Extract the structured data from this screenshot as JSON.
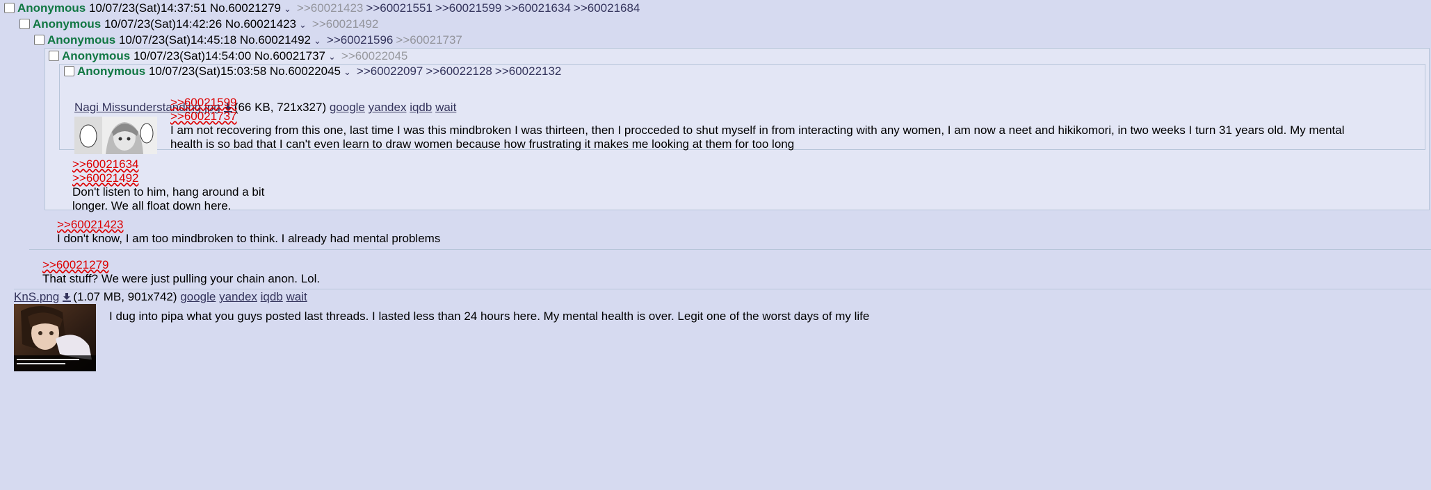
{
  "posts": [
    {
      "name": "Anonymous",
      "datetime": "10/07/23(Sat)14:37:51",
      "no": "No.60021279",
      "backlinks": [
        ">>60021423",
        ">>60021551",
        ">>60021599",
        ">>60021634",
        ">>60021684"
      ],
      "file": {
        "filename": "KnS.png",
        "info": "(1.07 MB, 901x742)"
      },
      "text": "I dug into pipa what you guys posted last threads. I lasted less than 24 hours here. My mental health is over. Legit one of the worst days of my life"
    },
    {
      "name": "Anonymous",
      "datetime": "10/07/23(Sat)14:42:26",
      "no": "No.60021423",
      "backlinks": [
        ">>60021492"
      ],
      "quotes": [
        ">>60021279"
      ],
      "text": "That stuff? We were just pulling your chain anon. Lol."
    },
    {
      "name": "Anonymous",
      "datetime": "10/07/23(Sat)14:45:18",
      "no": "No.60021492",
      "backlinks": [
        ">>60021596",
        ">>60021737"
      ],
      "quotes": [
        ">>60021423"
      ],
      "text": "I don't know, I am too mindbroken to think. I already had mental problems"
    },
    {
      "name": "Anonymous",
      "datetime": "10/07/23(Sat)14:54:00",
      "no": "No.60021737",
      "backlinks": [
        ">>60022045"
      ],
      "quotes": [
        ">>60021634",
        ">>60021492"
      ],
      "text_lines": [
        "Don't listen to him, hang around a bit",
        "longer. We all float down here."
      ]
    },
    {
      "name": "Anonymous",
      "datetime": "10/07/23(Sat)15:03:58",
      "no": "No.60022045",
      "backlinks": [
        ">>60022097",
        ">>60022128",
        ">>60022132"
      ],
      "file": {
        "filename": "Nagi Missunderstanding.jpg",
        "info": "(66 KB, 721x327)"
      },
      "quotes": [
        ">>60021599",
        ">>60021737"
      ],
      "text_lines": [
        "I am not recovering from this one, last time I was this mindbroken I was thirteen, then I procceded to shut myself in from interacting with any women, I am now a neet and hikikomori, in two weeks I turn 31 years old. My mental",
        "health is so bad that I can't even learn to draw women because how frustrating it makes me looking at them for too long"
      ]
    }
  ],
  "search_links": [
    "google",
    "yandex",
    "iqdb",
    "wait"
  ],
  "colors": {
    "bg": "#d6daf0",
    "name": "#117743",
    "quote": "#dd0000",
    "link": "#34345c",
    "border": "#b7c5d9"
  }
}
